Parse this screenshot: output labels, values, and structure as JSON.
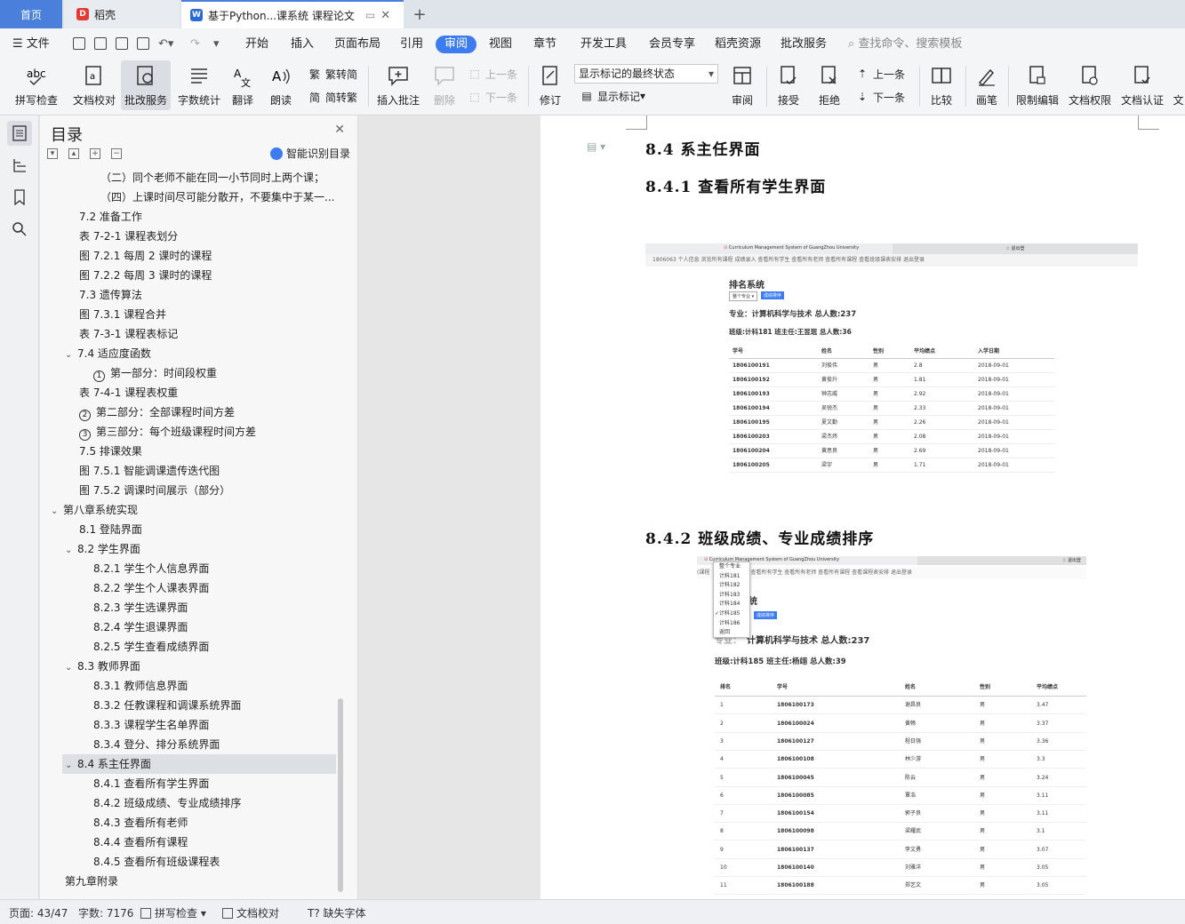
{
  "tabs": {
    "home": "首页",
    "daoke": "稻壳",
    "doc": "基于Python...课系统 课程论文"
  },
  "menu": {
    "file": "文件",
    "items": [
      "开始",
      "插入",
      "页面布局",
      "引用",
      "审阅",
      "视图",
      "章节",
      "开发工具",
      "会员专享",
      "稻壳资源",
      "批改服务"
    ],
    "search_placeholder": "查找命令、搜索模板"
  },
  "ribbon": {
    "spell": "拼写检查",
    "doc_check": "文档校对",
    "correct_service": "批改服务",
    "word_count": "字数统计",
    "translate": "翻译",
    "read_aloud": "朗读",
    "trad": "繁转简",
    "simp": "简转繁",
    "insert_comment": "插入批注",
    "delete": "删除",
    "prev": "上一条",
    "next": "下一条",
    "revise": "修订",
    "status_select": "显示标记的最终状态",
    "show_marks": "显示标记",
    "review": "审阅",
    "accept": "接受",
    "reject": "拒绝",
    "prev2": "上一条",
    "next2": "下一条",
    "compare": "比较",
    "pen": "画笔",
    "restrict_edit": "限制编辑",
    "doc_perm": "文档权限",
    "doc_cert": "文档认证",
    "more": "文"
  },
  "toc": {
    "title": "目录",
    "smart": "智能识别目录",
    "items": [
      {
        "text": "（二）同个老师不能在同一小节同时上两个课；",
        "level": 4
      },
      {
        "text": "（四）上课时间尽可能分散开，不要集中于某一...",
        "level": 4
      },
      {
        "text": "7.2  准备工作",
        "level": 2
      },
      {
        "text": "表 7-2-1  课程表划分",
        "level": 2
      },
      {
        "text": "图 7.2.1  每周 2 课时的课程",
        "level": 2
      },
      {
        "text": "图 7.2.2  每周 3 课时的课程",
        "level": 2
      },
      {
        "text": "7.3  遗传算法",
        "level": 2
      },
      {
        "text": "图 7.3.1  课程合并",
        "level": 2
      },
      {
        "text": "表 7-3-1  课程表标记",
        "level": 2
      },
      {
        "text": "7.4  适应度函数",
        "level": 2,
        "expand": true
      },
      {
        "text": "第一部分：时间段权重",
        "level": 3,
        "circ": "1"
      },
      {
        "text": "表 7-4-1  课程表权重",
        "level": 2
      },
      {
        "text": "第二部分：全部课程时间方差",
        "level": 2,
        "circ": "2"
      },
      {
        "text": "第三部分：每个班级课程时间方差",
        "level": 2,
        "circ": "3"
      },
      {
        "text": "7.5  排课效果",
        "level": 2
      },
      {
        "text": "图 7.5.1  智能调课遗传迭代图",
        "level": 2
      },
      {
        "text": "图 7.5.2  调课时间展示（部分）",
        "level": 2
      },
      {
        "text": "第八章系统实现",
        "level": 1,
        "expand": true
      },
      {
        "text": "8.1  登陆界面",
        "level": 2
      },
      {
        "text": "8.2  学生界面",
        "level": 2,
        "expand": true
      },
      {
        "text": "8.2.1  学生个人信息界面",
        "level": 3
      },
      {
        "text": "8.2.2  学生个人课表界面",
        "level": 3
      },
      {
        "text": "8.2.3  学生选课界面",
        "level": 3
      },
      {
        "text": "8.2.4  学生退课界面",
        "level": 3
      },
      {
        "text": "8.2.5  学生查看成绩界面",
        "level": 3
      },
      {
        "text": "8.3  教师界面",
        "level": 2,
        "expand": true
      },
      {
        "text": "8.3.1  教师信息界面",
        "level": 3
      },
      {
        "text": "8.3.2  任教课程和调课系统界面",
        "level": 3
      },
      {
        "text": "8.3.3  课程学生名单界面",
        "level": 3
      },
      {
        "text": "8.3.4  登分、排分系统界面",
        "level": 3
      },
      {
        "text": "8.4  系主任界面",
        "level": 2,
        "expand": true,
        "selected": true
      },
      {
        "text": "8.4.1  查看所有学生界面",
        "level": 3
      },
      {
        "text": "8.4.2  班级成绩、专业成绩排序",
        "level": 3
      },
      {
        "text": "8.4.3  查看所有老师",
        "level": 3
      },
      {
        "text": "8.4.4  查看所有课程",
        "level": 3
      },
      {
        "text": "8.4.5  查看所有班级课程表",
        "level": 3
      },
      {
        "text": "第九章附录",
        "level": 1
      }
    ]
  },
  "doc": {
    "h_84": "8.4  系主任界面",
    "h_841": "8.4.1  查看所有学生界面",
    "h_842": "8.4.2  班级成绩、专业成绩排序",
    "shot1": {
      "brand": "Curriculum Management System of GuangZhou University",
      "logout": "退出登",
      "nav": "1806063   个人信息   浏览所有课程   成绩录入   查看所有学生   查看所有老师   查看所有课程   查看班级课表安排   退出登录",
      "title": "排名系统",
      "select": "整个专业",
      "btn": "成绩排序",
      "major": "专业：计算机科学与技术 总人数:237",
      "class": "班级:计科181 班主任:王昱珉 总人数:36",
      "headers": [
        "学号",
        "姓名",
        "性别",
        "平均绩点",
        "入学日期"
      ],
      "rows": [
        [
          "1806100191",
          "刘俊伟",
          "男",
          "2.8",
          "2018-09-01"
        ],
        [
          "1806100192",
          "黄俊升",
          "男",
          "1.81",
          "2018-09-01"
        ],
        [
          "1806100193",
          "钟志威",
          "男",
          "2.92",
          "2018-09-01"
        ],
        [
          "1806100194",
          "吴锐杰",
          "男",
          "2.33",
          "2018-09-01"
        ],
        [
          "1806100195",
          "夏文勤",
          "男",
          "2.26",
          "2018-09-01"
        ],
        [
          "1806100203",
          "梁杰炜",
          "男",
          "2.08",
          "2018-09-01"
        ],
        [
          "1806100204",
          "黄思良",
          "男",
          "2.69",
          "2018-09-01"
        ],
        [
          "1806100205",
          "梁宇",
          "男",
          "1.71",
          "2018-09-01"
        ]
      ]
    },
    "shot2": {
      "brand": "Curriculum Management System of GuangZhou University",
      "logout": "退出登",
      "nav_prefix": "(课程",
      "nav": "查看所有学生   查看所有老师   查看所有课程   查看课程表安排   退出登录",
      "title": "统",
      "btn": "成绩排序",
      "dropdown": [
        "整个专业",
        "计科181",
        "计科182",
        "计科183",
        "计科184",
        "计科185",
        "计科186",
        "返回"
      ],
      "dropdown_checked": "计科185",
      "major_prefix": "专业：",
      "major": "计算机科学与技术 总人数:237",
      "class": "班级:计科185 班主任:杨翊 总人数:39",
      "headers": [
        "排名",
        "学号",
        "姓名",
        "性别",
        "平均绩点"
      ],
      "rows": [
        [
          "1",
          "1806100173",
          "谢昌良",
          "男",
          "3.47"
        ],
        [
          "2",
          "1806100024",
          "黄畅",
          "男",
          "3.37"
        ],
        [
          "3",
          "1806100127",
          "程日强",
          "男",
          "3.36"
        ],
        [
          "4",
          "1806100108",
          "林少游",
          "男",
          "3.3"
        ],
        [
          "5",
          "1806100045",
          "陈云",
          "男",
          "3.24"
        ],
        [
          "6",
          "1806100085",
          "覃浩",
          "男",
          "3.11"
        ],
        [
          "7",
          "1806100154",
          "郭子良",
          "男",
          "3.11"
        ],
        [
          "8",
          "1806100098",
          "梁耀武",
          "男",
          "3.1"
        ],
        [
          "9",
          "1806100137",
          "李文勇",
          "男",
          "3.07"
        ],
        [
          "10",
          "1806100140",
          "刘雅洋",
          "男",
          "3.05"
        ],
        [
          "11",
          "1806100188",
          "郑艺文",
          "男",
          "3.05"
        ]
      ]
    }
  },
  "status": {
    "page": "页面: 43/47",
    "words": "字数: 7176",
    "spell": "拼写检查",
    "doc_check": "文档校对",
    "missing_font": "缺失字体"
  },
  "colors": {
    "accent": "#3d7cf0",
    "home_tab": "#4a80dc",
    "daoke_logo": "#e53935",
    "wps_logo": "#2b6ad6"
  }
}
